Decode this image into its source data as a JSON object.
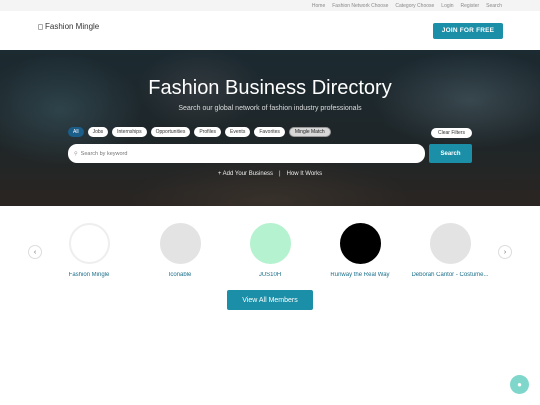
{
  "topnav": {
    "items": [
      "Home",
      "Fashion Network Choose",
      "Category Choose",
      "Login",
      "Register",
      "Search"
    ]
  },
  "header": {
    "logo_alt": "Fashion Mingle",
    "join_label": "JOIN FOR FREE"
  },
  "hero": {
    "title": "Fashion Business Directory",
    "subtitle": "Search our global network of fashion industry professionals",
    "filters": [
      "All",
      "Jobs",
      "Internships",
      "Opportunities",
      "Profiles",
      "Events",
      "Favorites",
      "Mingle Match"
    ],
    "active_filter": "All",
    "clear_label": "Clear Filters",
    "search_placeholder": "Search by keyword",
    "search_button": "Search",
    "add_business": "+ Add Your Business",
    "separator": "|",
    "how_it_works": "How It Works"
  },
  "members": {
    "items": [
      {
        "name": "Fashion Mingle",
        "avatar_color": "#ffffff",
        "avatar_border": "#eeeeee"
      },
      {
        "name": "Iconable",
        "avatar_color": "#e3e3e3",
        "avatar_border": "#e3e3e3"
      },
      {
        "name": "JUS10H",
        "avatar_color": "#b5f2cf",
        "avatar_border": "#b5f2cf"
      },
      {
        "name": "Runway the Real Way",
        "avatar_color": "#000000",
        "avatar_border": "#000000"
      },
      {
        "name": "Deborah Cantor - Costume...",
        "avatar_color": "#e3e3e3",
        "avatar_border": "#e3e3e3"
      }
    ],
    "prev_icon": "chevron-left-icon",
    "next_icon": "chevron-right-icon",
    "view_all_label": "View All Members"
  },
  "colors": {
    "accent": "#1b8fa8",
    "active_chip": "#1b5e8a",
    "fab": "#7fd6cb"
  },
  "fab_icon": "chat-icon"
}
